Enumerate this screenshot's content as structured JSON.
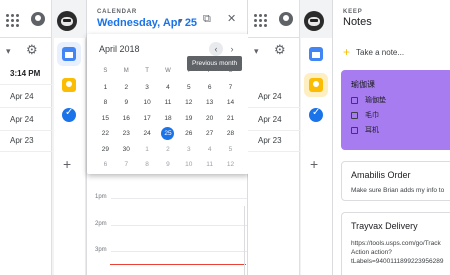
{
  "left_app": {
    "times": [
      "3:14 PM",
      "Apr 24",
      "Apr 24",
      "Apr 23"
    ]
  },
  "calendar": {
    "app_label": "CALENDAR",
    "date_title": "Wednesday, Apr 25",
    "month_label": "April 2018",
    "tooltip": "Previous month",
    "weekdays": [
      "S",
      "M",
      "T",
      "W",
      "T",
      "F",
      "S"
    ],
    "weeks": [
      [
        "1",
        "2",
        "3",
        "4",
        "5",
        "6",
        "7"
      ],
      [
        "8",
        "9",
        "10",
        "11",
        "12",
        "13",
        "14"
      ],
      [
        "15",
        "16",
        "17",
        "18",
        "19",
        "20",
        "21"
      ],
      [
        "22",
        "23",
        "24",
        "25",
        "26",
        "27",
        "28"
      ],
      [
        "29",
        "30",
        "1",
        "2",
        "3",
        "4",
        "5"
      ],
      [
        "6",
        "7",
        "8",
        "9",
        "10",
        "11",
        "12"
      ]
    ],
    "today": "25",
    "hours": [
      "1pm",
      "2pm",
      "3pm"
    ]
  },
  "mid_app": {
    "times": [
      "Apr 24",
      "Apr 24",
      "Apr 23"
    ]
  },
  "keep": {
    "app_label": "KEEP",
    "title": "Notes",
    "take_note": "Take a note...",
    "notes": [
      {
        "title": "瑜伽课",
        "items": [
          "瑜伽垫",
          "毛巾",
          "耳机"
        ],
        "color": "#a67cf0"
      },
      {
        "title": "Amabilis Order",
        "body": "Make sure Brian adds my info to"
      },
      {
        "title": "Trayvax Delivery",
        "body_lines": [
          "https://tools.usps.com/go/Track",
          "Action action?",
          "tLabels=9400111899223956289"
        ]
      }
    ]
  }
}
